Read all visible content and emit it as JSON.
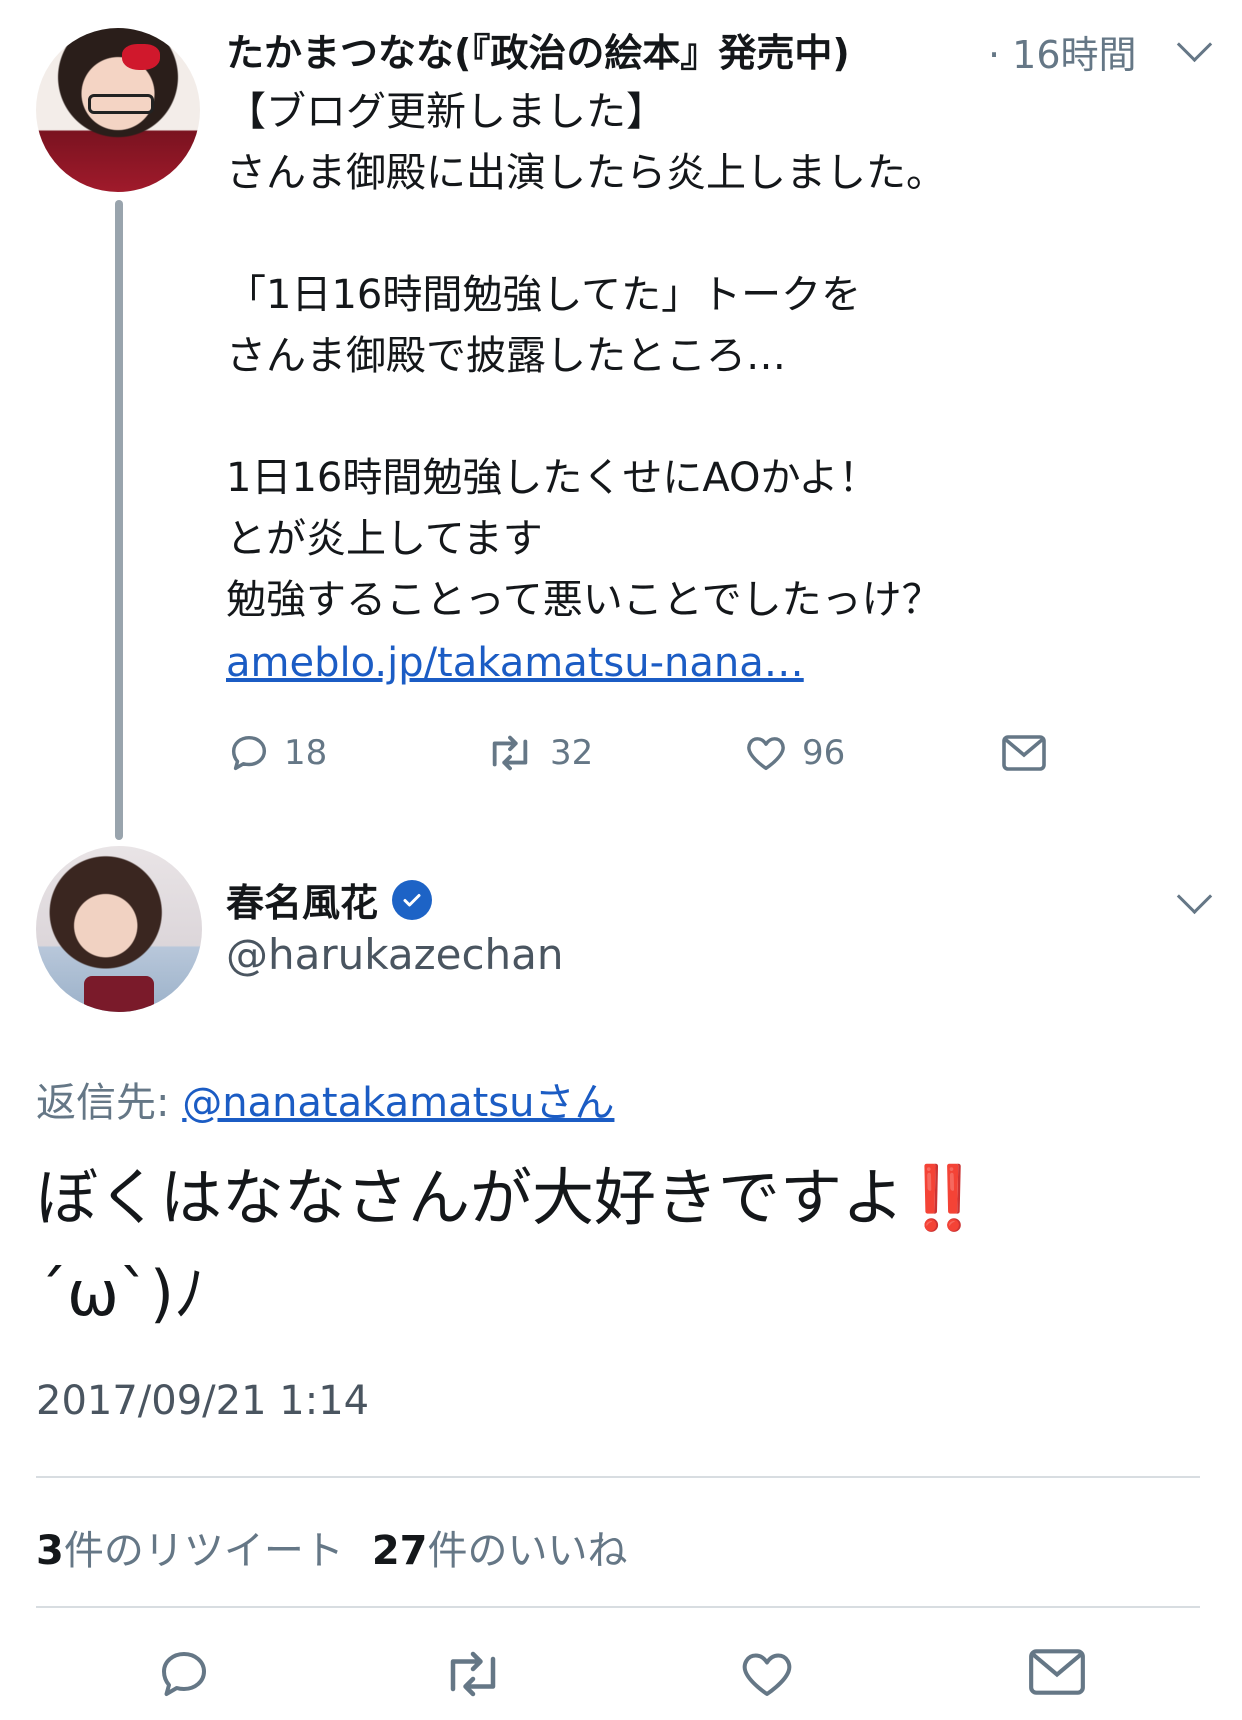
{
  "parent_tweet": {
    "author_name": "たかまつなな(『政治の絵本』発売中)",
    "time": "· 16時間",
    "text": "【ブログ更新しました】\nさんま御殿に出演したら炎上しました。\n\n「1日16時間勉強してた」トークを\nさんま御殿で披露したところ…\n\n1日16時間勉強したくせにAOかよ！\nとが炎上してます\n勉強することって悪いことでしたっけ？",
    "link": "ameblo.jp/takamatsu-nana…",
    "reply_count": "18",
    "retweet_count": "32",
    "like_count": "96"
  },
  "reply_tweet": {
    "author_name": "春名風花",
    "handle": "@harukazechan",
    "reply_to_label": "返信先: ",
    "reply_to_link": "@nanatakamatsuさん",
    "text_main": "ぼくはななさんが大好きですよ",
    "text_emoji": "‼️",
    "text_kaomoji": "´ω`)ﾉ",
    "timestamp": "2017/09/21 1:14",
    "retweets_num": "3",
    "retweets_label": "件のリツイート",
    "likes_num": "27",
    "likes_label": "件のいいね"
  },
  "icons": {
    "reply": "reply-icon",
    "retweet": "retweet-icon",
    "like": "heart-icon",
    "dm": "mail-icon",
    "verified": "verified-badge-icon",
    "menu": "chevron-down-icon"
  },
  "colors": {
    "link": "#1b5cc4",
    "muted": "#657786",
    "verified": "#1d63c6",
    "thread_line": "#99a4ad"
  }
}
